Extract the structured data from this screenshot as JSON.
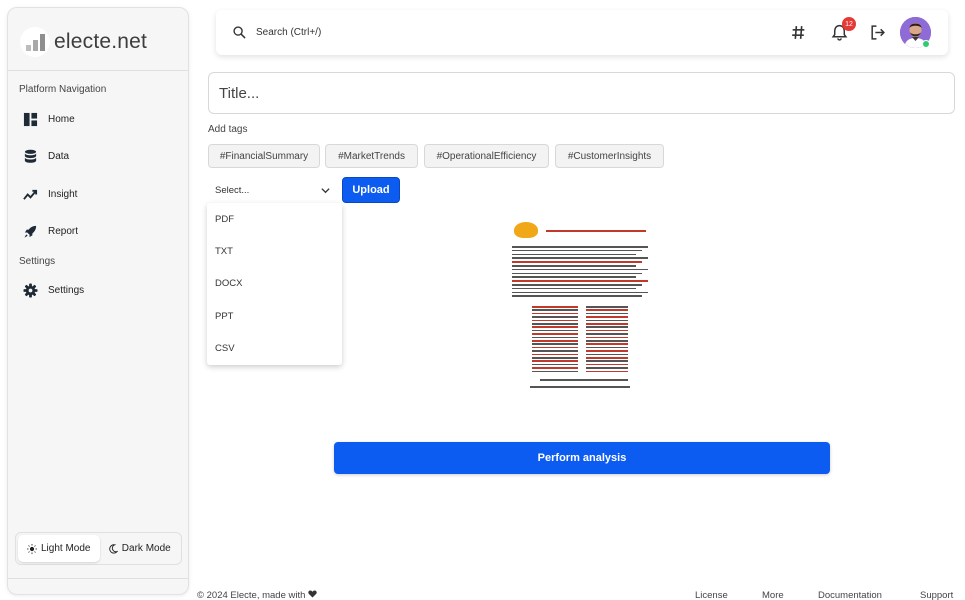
{
  "sidebar": {
    "logo_text": "electe.net",
    "section_platform": "Platform Navigation",
    "items": [
      {
        "label": "Home",
        "icon": "dashboard-icon"
      },
      {
        "label": "Data",
        "icon": "database-icon"
      },
      {
        "label": "Insight",
        "icon": "trend-icon"
      },
      {
        "label": "Report",
        "icon": "rocket-icon"
      }
    ],
    "section_settings": "Settings",
    "settings_item": {
      "label": "Settings",
      "icon": "gear-icon"
    },
    "mode": {
      "light_label": "Light Mode",
      "dark_label": "Dark Mode",
      "active": "light"
    }
  },
  "topbar": {
    "search_text": "Search (Ctrl+/)",
    "notification_count": "12"
  },
  "main": {
    "title_placeholder": "Title...",
    "tags_label": "Add tags",
    "tags": [
      "#FinancialSummary",
      "#MarketTrends",
      "#OperationalEfficiency",
      "#CustomerInsights"
    ],
    "select_placeholder": "Select...",
    "upload_label": "Upload",
    "dropdown_options": [
      "PDF",
      "TXT",
      "DOCX",
      "PPT",
      "CSV"
    ],
    "analysis_label": "Perform analysis"
  },
  "footer": {
    "copyright": "© 2024 Electe, made with",
    "links": [
      "License",
      "More",
      "Documentation",
      "Support"
    ]
  },
  "colors": {
    "primary": "#0d5cf2",
    "badge": "#e53935",
    "online": "#2ecc71"
  }
}
